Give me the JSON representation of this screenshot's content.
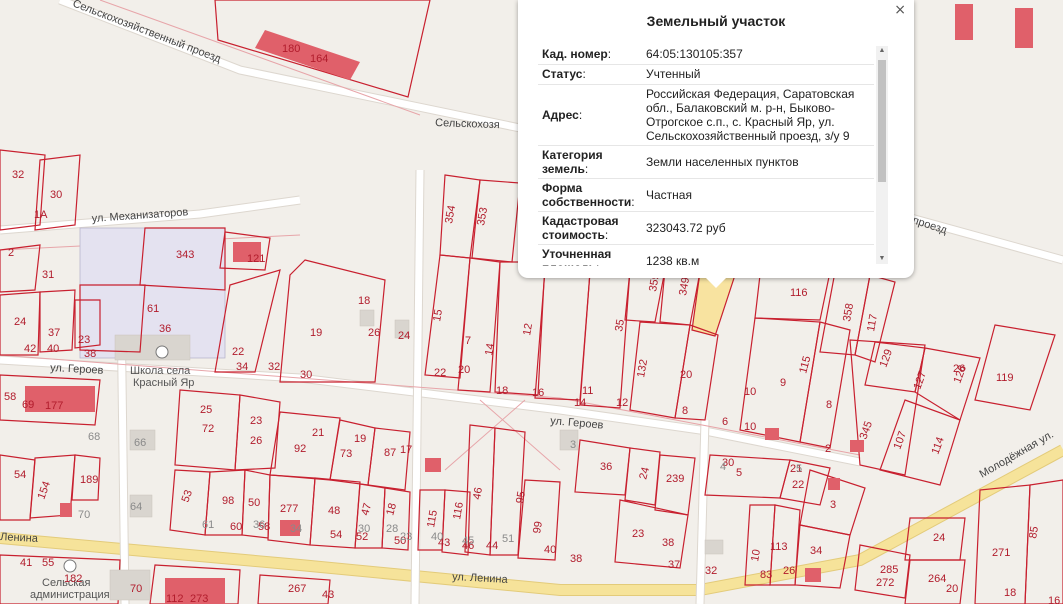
{
  "popup": {
    "title": "Земельный участок",
    "close_glyph": "×",
    "rows": [
      {
        "label": "Кад. номер",
        "value": "64:05:130105:357"
      },
      {
        "label": "Статус",
        "value": "Учтенный"
      },
      {
        "label": "Адрес",
        "value": "Российская Федерация, Саратовская обл., Балаковский м. р-н, Быково-Отрогское с.п., с. Красный Яр, ул. Сельскохозяйственный проезд, з/у 9"
      },
      {
        "label": "Категория земель",
        "value": "Земли населенных пунктов"
      },
      {
        "label": "Форма собственности",
        "value": "Частная"
      },
      {
        "label": "Кадастровая стоимость",
        "value": "323043.72 руб"
      },
      {
        "label": "Уточненная площадь",
        "value": "1238 кв.м"
      }
    ],
    "scroll_up": "▲",
    "scroll_down": "▼"
  },
  "streets": {
    "selkhoz_1": "Сельскохозяйственный проезд",
    "selkhoz_2": "Сельскохозя",
    "selkhoz_3": "проезд",
    "mekhanizatorov": "ул. Механизаторов",
    "geroev_left": "ул. Героев",
    "geroev_mid": "ул. Героев",
    "lenina_left": "Ленина",
    "lenina_mid": "ул. Ленина",
    "molodezhnaya": "Молодёжная ул."
  },
  "pois": {
    "school_1": "Школа села",
    "school_2": "Красный Яр",
    "admin_1": "Сельская",
    "admin_2": "администрация"
  },
  "parcels_red": [
    "180",
    "164",
    "32",
    "30",
    "1А",
    "343",
    "121",
    "61",
    "36",
    "31",
    "2",
    "24",
    "37",
    "23",
    "40",
    "38",
    "42",
    "22",
    "34",
    "18",
    "19",
    "26",
    "24",
    "32",
    "30",
    "354",
    "353",
    "15",
    "7",
    "14",
    "12",
    "22",
    "20",
    "18",
    "16",
    "11",
    "14",
    "12",
    "35",
    "359",
    "349",
    "132",
    "20",
    "10",
    "8",
    "116",
    "358",
    "117",
    "115",
    "9",
    "10",
    "6",
    "129",
    "127",
    "126",
    "119",
    "8",
    "345",
    "107",
    "114",
    "2",
    "26",
    "69",
    "177",
    "58",
    "72",
    "26",
    "92",
    "73",
    "87",
    "25",
    "23",
    "21",
    "19",
    "17",
    "54",
    "154",
    "189",
    "53",
    "98",
    "50",
    "277",
    "48",
    "47",
    "18",
    "60",
    "58",
    "54",
    "52",
    "50",
    "115",
    "116",
    "46",
    "95",
    "99",
    "43",
    "46",
    "44",
    "40",
    "38",
    "36",
    "24",
    "239",
    "23",
    "38",
    "37",
    "32",
    "30",
    "5",
    "22",
    "21",
    "3",
    "10",
    "113",
    "34",
    "83",
    "26",
    "24",
    "271",
    "85",
    "285",
    "264",
    "272",
    "20",
    "18",
    "16",
    "182",
    "70",
    "112",
    "273",
    "267",
    "43",
    "41",
    "55",
    "48"
  ],
  "parcels_grey": [
    "66",
    "68",
    "64",
    "70",
    "61",
    "36",
    "34",
    "30",
    "28",
    "23",
    "40",
    "45",
    "51",
    "3",
    "5",
    "4"
  ],
  "colors": {
    "parcel_border": "#c8202f",
    "selected_fill": "#f8e3a0",
    "building_highlight": "#e0606a",
    "main_road": "#f6e39a"
  }
}
